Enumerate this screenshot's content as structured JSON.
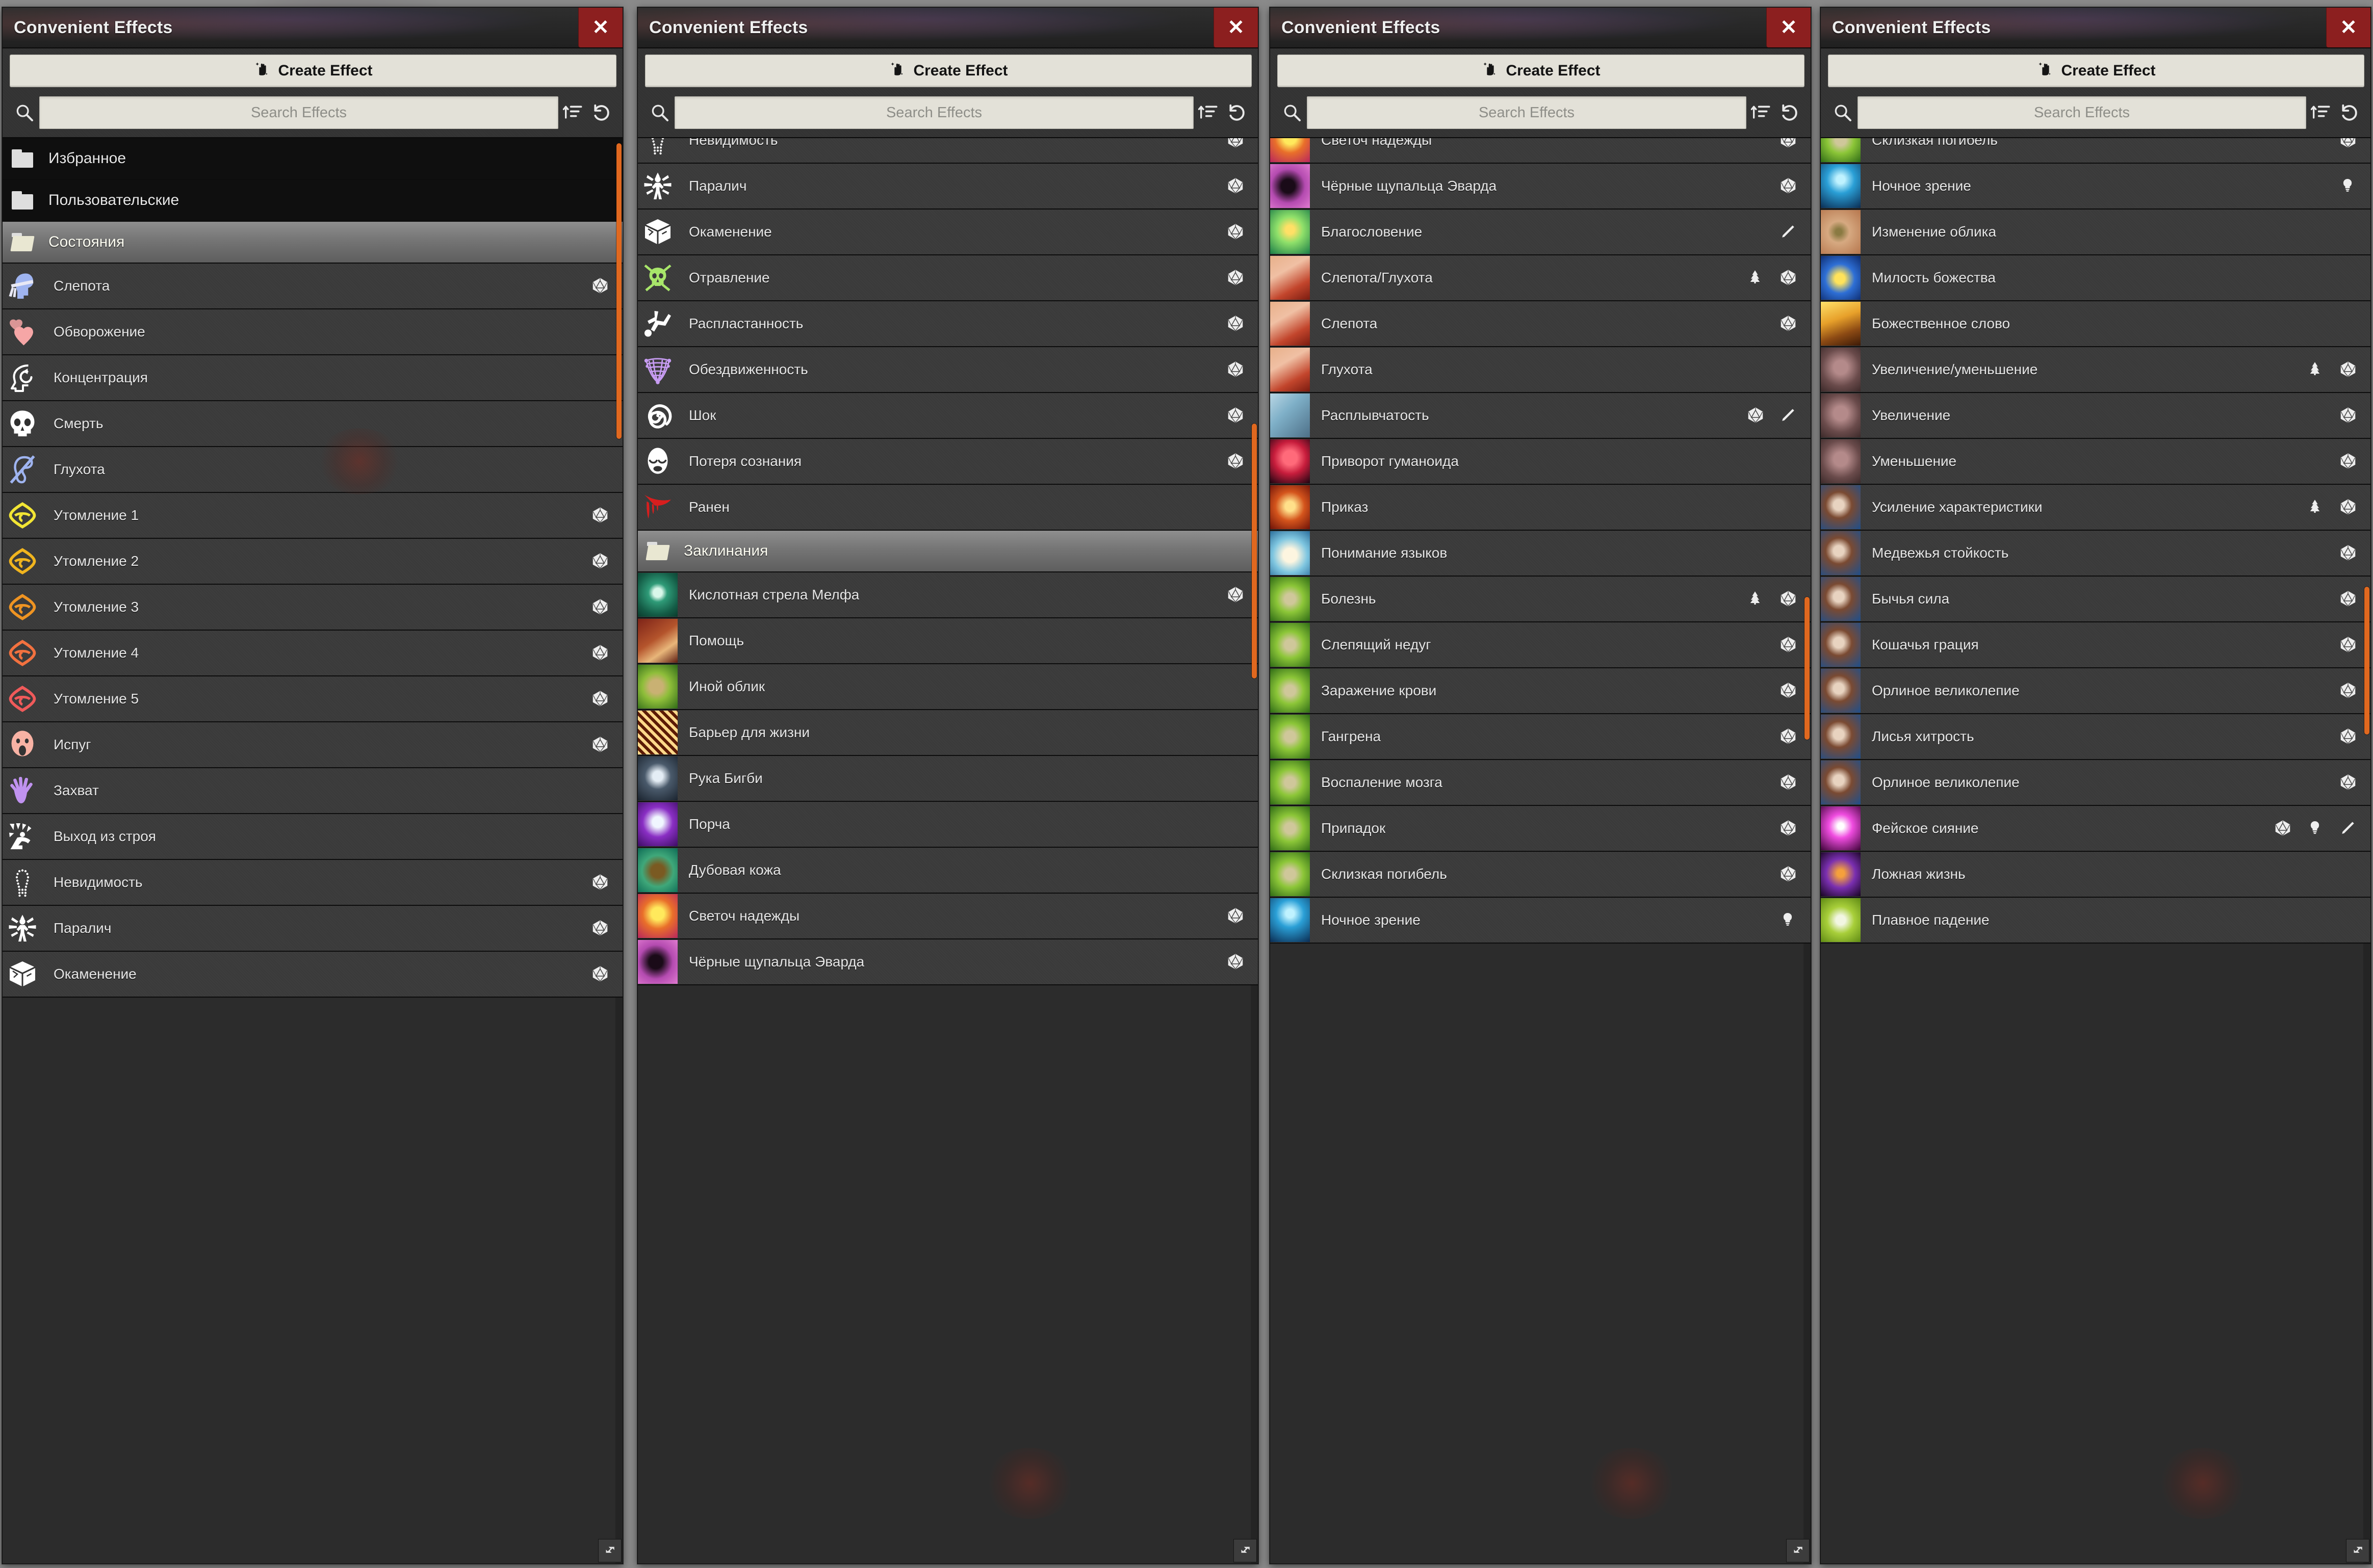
{
  "window": {
    "title": "Convenient Effects",
    "close_label": "✕",
    "create_label": "Create Effect",
    "search_placeholder": "Search Effects",
    "icons": {
      "create": "hand-effect-icon",
      "search": "search-icon",
      "sort": "sort-icon",
      "reset": "reset-icon",
      "close": "close-icon",
      "resize": "resize-grip-icon"
    },
    "accent_color": "#e0681f",
    "close_color": "#8c1f1f",
    "button_color": "#e3e1d8"
  },
  "row_actions": {
    "d20": "d20-die-icon",
    "tree": "pine-tree-icon",
    "pencil": "pencil-icon",
    "bulb": "lightbulb-icon"
  },
  "panels": [
    {
      "id": "panel-1",
      "rows": [
        {
          "label": "Избранное",
          "type": "folder",
          "active": false,
          "icon": "folder-closed-icon",
          "acts": []
        },
        {
          "label": "Пользовательские",
          "type": "folder",
          "active": false,
          "icon": "folder-closed-icon",
          "acts": []
        },
        {
          "label": "Состояния",
          "type": "folder",
          "active": true,
          "icon": "folder-open-icon",
          "acts": []
        },
        {
          "label": "Слепота",
          "type": "effect",
          "icon": "blindfolded-head-icon",
          "color": "#9fb4f0",
          "acts": [
            "d20"
          ]
        },
        {
          "label": "Обворожение",
          "type": "effect",
          "icon": "two-hearts-icon",
          "color": "#f6a6a6",
          "acts": []
        },
        {
          "label": "Концентрация",
          "type": "effect",
          "icon": "head-loop-icon",
          "color": "#ffffff",
          "acts": []
        },
        {
          "label": "Смерть",
          "type": "effect",
          "icon": "skull-icon",
          "color": "#ffffff",
          "acts": []
        },
        {
          "label": "Глухота",
          "type": "effect",
          "icon": "crossed-ear-icon",
          "color": "#9fb4f0",
          "acts": []
        },
        {
          "label": "Утомление 1",
          "type": "effect",
          "icon": "tired-eye-icon",
          "color": "#f2e534",
          "acts": [
            "d20"
          ]
        },
        {
          "label": "Утомление 2",
          "type": "effect",
          "icon": "tired-eye-icon",
          "color": "#f0b41e",
          "acts": [
            "d20"
          ]
        },
        {
          "label": "Утомление 3",
          "type": "effect",
          "icon": "tired-eye-icon",
          "color": "#ef9422",
          "acts": [
            "d20"
          ]
        },
        {
          "label": "Утомление 4",
          "type": "effect",
          "icon": "tired-eye-icon",
          "color": "#f2713f",
          "acts": [
            "d20"
          ]
        },
        {
          "label": "Утомление 5",
          "type": "effect",
          "icon": "tired-eye-icon",
          "color": "#f05a5a",
          "acts": [
            "d20"
          ]
        },
        {
          "label": "Испуг",
          "type": "effect",
          "icon": "screaming-face-icon",
          "color": "#f8b2a4",
          "acts": [
            "d20"
          ]
        },
        {
          "label": "Захват",
          "type": "effect",
          "icon": "open-hand-icon",
          "color": "#c092f0",
          "acts": []
        },
        {
          "label": "Выход из строя",
          "type": "effect",
          "icon": "incapacitated-icon",
          "color": "#ffffff",
          "acts": []
        },
        {
          "label": "Невидимость",
          "type": "effect",
          "icon": "dotted-figure-icon",
          "color": "#ffffff",
          "acts": [
            "d20"
          ]
        },
        {
          "label": "Паралич",
          "type": "effect",
          "icon": "paralysis-figure-icon",
          "color": "#ffffff",
          "acts": [
            "d20"
          ]
        },
        {
          "label": "Окаменение",
          "type": "effect",
          "icon": "stone-cube-icon",
          "color": "#ffffff",
          "acts": [
            "d20"
          ]
        }
      ]
    },
    {
      "id": "panel-2",
      "rows": [
        {
          "label": "Невидимость",
          "type": "effect",
          "icon": "dotted-figure-icon",
          "color": "#ffffff",
          "acts": [
            "d20"
          ],
          "clipped_top": true
        },
        {
          "label": "Паралич",
          "type": "effect",
          "icon": "paralysis-figure-icon",
          "color": "#ffffff",
          "acts": [
            "d20"
          ]
        },
        {
          "label": "Окаменение",
          "type": "effect",
          "icon": "stone-cube-icon",
          "color": "#ffffff",
          "acts": [
            "d20"
          ]
        },
        {
          "label": "Отравление",
          "type": "effect",
          "icon": "poison-skull-icon",
          "color": "#a8e66a",
          "acts": [
            "d20"
          ]
        },
        {
          "label": "Распластанность",
          "type": "effect",
          "icon": "prone-figure-icon",
          "color": "#ffffff",
          "acts": [
            "d20"
          ]
        },
        {
          "label": "Обездвиженность",
          "type": "effect",
          "icon": "net-icon",
          "color": "#c79cf2",
          "acts": [
            "d20"
          ]
        },
        {
          "label": "Шок",
          "type": "effect",
          "icon": "spiral-icon",
          "color": "#ffffff",
          "acts": [
            "d20"
          ]
        },
        {
          "label": "Потеря сознания",
          "type": "effect",
          "icon": "sleeping-face-icon",
          "color": "#ffffff",
          "acts": [
            "d20"
          ]
        },
        {
          "label": "Ранен",
          "type": "effect",
          "icon": "blood-drip-icon",
          "color": "#d81e1e",
          "acts": []
        },
        {
          "label": "Заклинания",
          "type": "folder",
          "active": true,
          "icon": "folder-open-icon",
          "acts": []
        },
        {
          "label": "Кислотная стрела Мелфа",
          "type": "effect",
          "icon": "art-acid-arrow",
          "art": "acid-arrow",
          "acts": [
            "d20"
          ]
        },
        {
          "label": "Помощь",
          "type": "effect",
          "icon": "art-aid",
          "art": "aid",
          "acts": []
        },
        {
          "label": "Иной облик",
          "type": "effect",
          "icon": "art-alter-self",
          "art": "alter-self",
          "acts": []
        },
        {
          "label": "Барьер для жизни",
          "type": "effect",
          "icon": "art-life-barrier",
          "art": "life-barrier",
          "acts": []
        },
        {
          "label": "Рука Бигби",
          "type": "effect",
          "icon": "art-bigbys-hand",
          "art": "bigbys-hand",
          "acts": []
        },
        {
          "label": "Порча",
          "type": "effect",
          "icon": "art-bane",
          "art": "bane",
          "acts": []
        },
        {
          "label": "Дубовая кожа",
          "type": "effect",
          "icon": "art-barkskin",
          "art": "barkskin",
          "acts": []
        },
        {
          "label": "Светоч надежды",
          "type": "effect",
          "icon": "art-beacon-of-hope",
          "art": "beacon",
          "acts": [
            "d20"
          ]
        },
        {
          "label": "Чёрные щупальца Эварда",
          "type": "effect",
          "icon": "art-black-tentacles",
          "art": "tentacles",
          "acts": [
            "d20"
          ],
          "clipped_bottom": true
        }
      ]
    },
    {
      "id": "panel-3",
      "rows": [
        {
          "label": "Светоч надежды",
          "type": "effect",
          "icon": "art-beacon-of-hope",
          "art": "beacon",
          "acts": [
            "d20"
          ],
          "clipped_top": true
        },
        {
          "label": "Чёрные щупальца Эварда",
          "type": "effect",
          "icon": "art-black-tentacles",
          "art": "tentacles",
          "acts": [
            "d20"
          ]
        },
        {
          "label": "Благословение",
          "type": "effect",
          "icon": "art-bless",
          "art": "bless",
          "acts": [
            "pencil"
          ]
        },
        {
          "label": "Слепота/Глухота",
          "type": "effect",
          "icon": "art-blindness-deafness",
          "art": "blind",
          "acts": [
            "tree",
            "d20"
          ]
        },
        {
          "label": "Слепота",
          "type": "effect",
          "icon": "art-blindness",
          "art": "blind",
          "acts": [
            "d20"
          ]
        },
        {
          "label": "Глухота",
          "type": "effect",
          "icon": "art-deafness",
          "art": "blind",
          "acts": []
        },
        {
          "label": "Расплывчатость",
          "type": "effect",
          "icon": "art-blur",
          "art": "blur",
          "acts": [
            "d20",
            "pencil"
          ]
        },
        {
          "label": "Приворот гуманоида",
          "type": "effect",
          "icon": "art-charm-person",
          "art": "charm",
          "acts": []
        },
        {
          "label": "Приказ",
          "type": "effect",
          "icon": "art-command",
          "art": "command",
          "acts": []
        },
        {
          "label": "Понимание языков",
          "type": "effect",
          "icon": "art-comprehend-languages",
          "art": "book",
          "acts": []
        },
        {
          "label": "Болезнь",
          "type": "effect",
          "icon": "art-contagion",
          "art": "contagion",
          "acts": [
            "tree",
            "d20"
          ]
        },
        {
          "label": "Слепящий недуг",
          "type": "effect",
          "icon": "art-contagion",
          "art": "contagion",
          "acts": [
            "d20"
          ]
        },
        {
          "label": "Заражение крови",
          "type": "effect",
          "icon": "art-contagion",
          "art": "contagion",
          "acts": [
            "d20"
          ]
        },
        {
          "label": "Гангрена",
          "type": "effect",
          "icon": "art-contagion",
          "art": "contagion",
          "acts": [
            "d20"
          ]
        },
        {
          "label": "Воспаление мозга",
          "type": "effect",
          "icon": "art-contagion",
          "art": "contagion",
          "acts": [
            "d20"
          ]
        },
        {
          "label": "Припадок",
          "type": "effect",
          "icon": "art-contagion",
          "art": "contagion",
          "acts": [
            "d20"
          ]
        },
        {
          "label": "Склизкая погибель",
          "type": "effect",
          "icon": "art-contagion",
          "art": "contagion",
          "acts": [
            "d20"
          ]
        },
        {
          "label": "Ночное зрение",
          "type": "effect",
          "icon": "art-darkvision",
          "art": "darkvision",
          "acts": [
            "bulb"
          ],
          "clipped_bottom": true
        }
      ]
    },
    {
      "id": "panel-4",
      "rows": [
        {
          "label": "Склизкая погибель",
          "type": "effect",
          "icon": "art-contagion",
          "art": "contagion",
          "acts": [
            "d20"
          ],
          "clipped_top": true
        },
        {
          "label": "Ночное зрение",
          "type": "effect",
          "icon": "art-darkvision",
          "art": "darkvision",
          "acts": [
            "bulb"
          ]
        },
        {
          "label": "Изменение облика",
          "type": "effect",
          "icon": "art-disguise-self",
          "art": "eye",
          "acts": []
        },
        {
          "label": "Милость божества",
          "type": "effect",
          "icon": "art-divine-favor",
          "art": "mace",
          "acts": []
        },
        {
          "label": "Божественное слово",
          "type": "effect",
          "icon": "art-divine-word",
          "art": "divine-word",
          "acts": []
        },
        {
          "label": "Увеличение/уменьшение",
          "type": "effect",
          "icon": "art-enlarge-reduce",
          "art": "figure",
          "acts": [
            "tree",
            "d20"
          ]
        },
        {
          "label": "Увеличение",
          "type": "effect",
          "icon": "art-enlarge",
          "art": "figure",
          "acts": [
            "d20"
          ]
        },
        {
          "label": "Уменьшение",
          "type": "effect",
          "icon": "art-reduce",
          "art": "figure",
          "acts": [
            "d20"
          ]
        },
        {
          "label": "Усиление характеристики",
          "type": "effect",
          "icon": "art-enhance-ability",
          "art": "boot",
          "acts": [
            "tree",
            "d20"
          ]
        },
        {
          "label": "Медвежья стойкость",
          "type": "effect",
          "icon": "art-enhance-ability",
          "art": "boot",
          "acts": [
            "d20"
          ]
        },
        {
          "label": "Бычья сила",
          "type": "effect",
          "icon": "art-enhance-ability",
          "art": "boot",
          "acts": [
            "d20"
          ]
        },
        {
          "label": "Кошачья грация",
          "type": "effect",
          "icon": "art-enhance-ability",
          "art": "boot",
          "acts": [
            "d20"
          ]
        },
        {
          "label": "Орлиное великолепие",
          "type": "effect",
          "icon": "art-enhance-ability",
          "art": "boot",
          "acts": [
            "d20"
          ]
        },
        {
          "label": "Лисья хитрость",
          "type": "effect",
          "icon": "art-enhance-ability",
          "art": "boot",
          "acts": [
            "d20"
          ]
        },
        {
          "label": "Орлиное великолепие",
          "type": "effect",
          "icon": "art-enhance-ability",
          "art": "boot",
          "acts": [
            "d20"
          ]
        },
        {
          "label": "Фейское сияние",
          "type": "effect",
          "icon": "art-faerie-fire",
          "art": "faerie",
          "acts": [
            "d20",
            "bulb",
            "pencil"
          ]
        },
        {
          "label": "Ложная жизнь",
          "type": "effect",
          "icon": "art-false-life",
          "art": "false-life",
          "acts": []
        },
        {
          "label": "Плавное падение",
          "type": "effect",
          "icon": "art-feather-fall",
          "art": "feather",
          "acts": [],
          "clipped_bottom": true
        }
      ]
    }
  ]
}
